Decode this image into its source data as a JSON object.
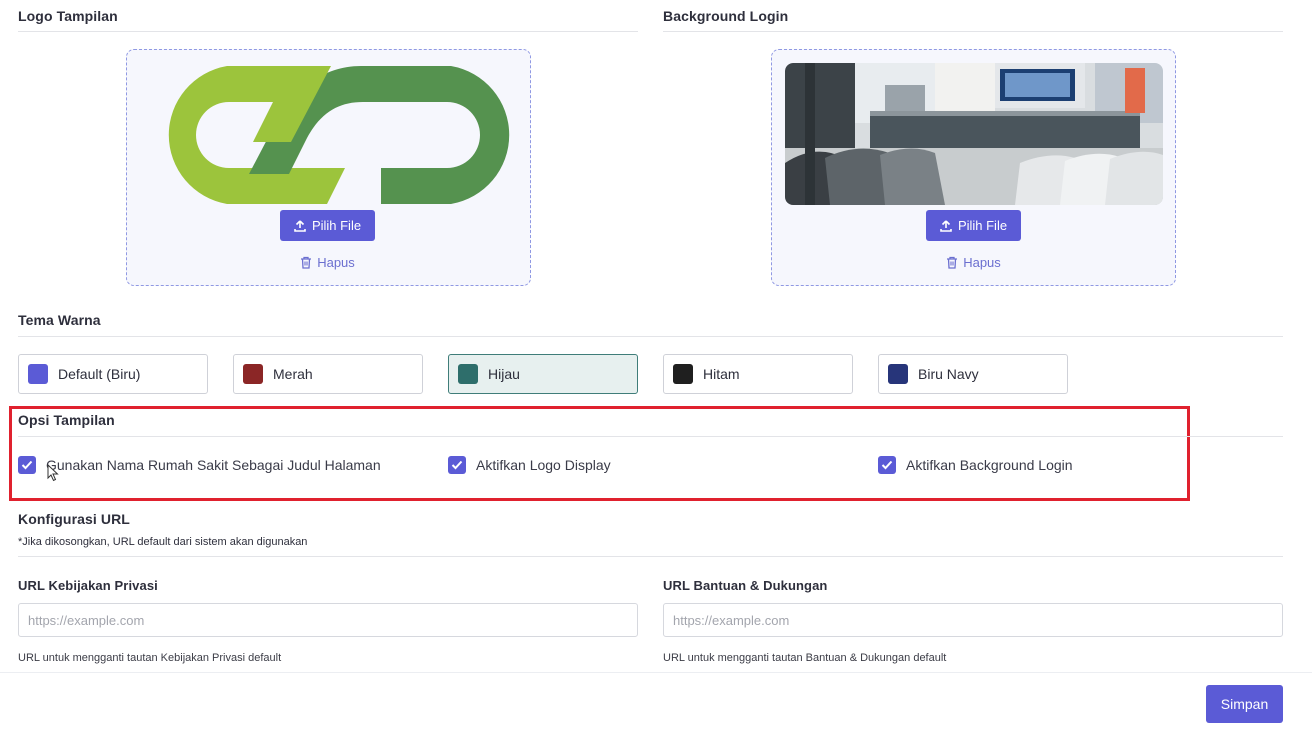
{
  "logo": {
    "title": "Logo Tampilan",
    "upload_label": "Pilih File",
    "delete_label": "Hapus",
    "colors": {
      "light": "#9cc43c",
      "dark": "#55924f"
    }
  },
  "background": {
    "title": "Background Login",
    "upload_label": "Pilih File",
    "delete_label": "Hapus"
  },
  "theme": {
    "title": "Tema Warna",
    "options": [
      {
        "label": "Default (Biru)",
        "color": "#5b5bd6",
        "selected": false
      },
      {
        "label": "Merah",
        "color": "#8b2626",
        "selected": false
      },
      {
        "label": "Hijau",
        "color": "#2e6e6b",
        "selected": true
      },
      {
        "label": "Hitam",
        "color": "#1f1f1f",
        "selected": false
      },
      {
        "label": "Biru Navy",
        "color": "#27357a",
        "selected": false
      }
    ]
  },
  "display_options": {
    "title": "Opsi Tampilan",
    "items": [
      {
        "label": "Gunakan Nama Rumah Sakit Sebagai Judul Halaman",
        "checked": true
      },
      {
        "label": "Aktifkan Logo Display",
        "checked": true
      },
      {
        "label": "Aktifkan Background Login",
        "checked": true
      }
    ]
  },
  "url_config": {
    "title": "Konfigurasi URL",
    "note": "*Jika dikosongkan, URL default dari sistem akan digunakan",
    "privacy": {
      "label": "URL Kebijakan Privasi",
      "placeholder": "https://example.com",
      "hint": "URL untuk mengganti tautan Kebijakan Privasi default"
    },
    "support": {
      "label": "URL Bantuan & Dukungan",
      "placeholder": "https://example.com",
      "hint": "URL untuk mengganti tautan Bantuan & Dukungan default"
    }
  },
  "footer": {
    "save_label": "Simpan"
  },
  "colors": {
    "accent": "#5b5bd6",
    "highlight": "#e0212e"
  }
}
